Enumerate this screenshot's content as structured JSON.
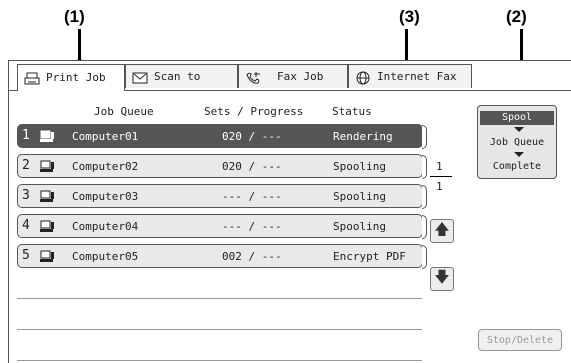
{
  "callouts": {
    "c1": "(1)",
    "c2": "(2)",
    "c3": "(3)"
  },
  "tabs": [
    {
      "label": "Print Job",
      "icon": "printer-icon"
    },
    {
      "label": "Scan to",
      "icon": "scan-icon"
    },
    {
      "label": "Fax Job",
      "icon": "fax-icon"
    },
    {
      "label": "Internet Fax",
      "icon": "internet-fax-icon"
    }
  ],
  "columns": {
    "job_queue": "Job Queue",
    "sets_progress": "Sets / Progress",
    "status": "Status"
  },
  "jobs": [
    {
      "num": "1",
      "name": "Computer01",
      "sets": "020 / ---",
      "status": "Rendering"
    },
    {
      "num": "2",
      "name": "Computer02",
      "sets": "020 / ---",
      "status": "Spooling"
    },
    {
      "num": "3",
      "name": "Computer03",
      "sets": "--- / ---",
      "status": "Spooling"
    },
    {
      "num": "4",
      "name": "Computer04",
      "sets": "--- / ---",
      "status": "Spooling"
    },
    {
      "num": "5",
      "name": "Computer05",
      "sets": "002 / ---",
      "status": "Encrypt PDF"
    }
  ],
  "pager": {
    "current": "1",
    "total": "1"
  },
  "mode": {
    "spool": "Spool",
    "job_queue": "Job Queue",
    "complete": "Complete"
  },
  "stop_delete": "Stop/Delete"
}
